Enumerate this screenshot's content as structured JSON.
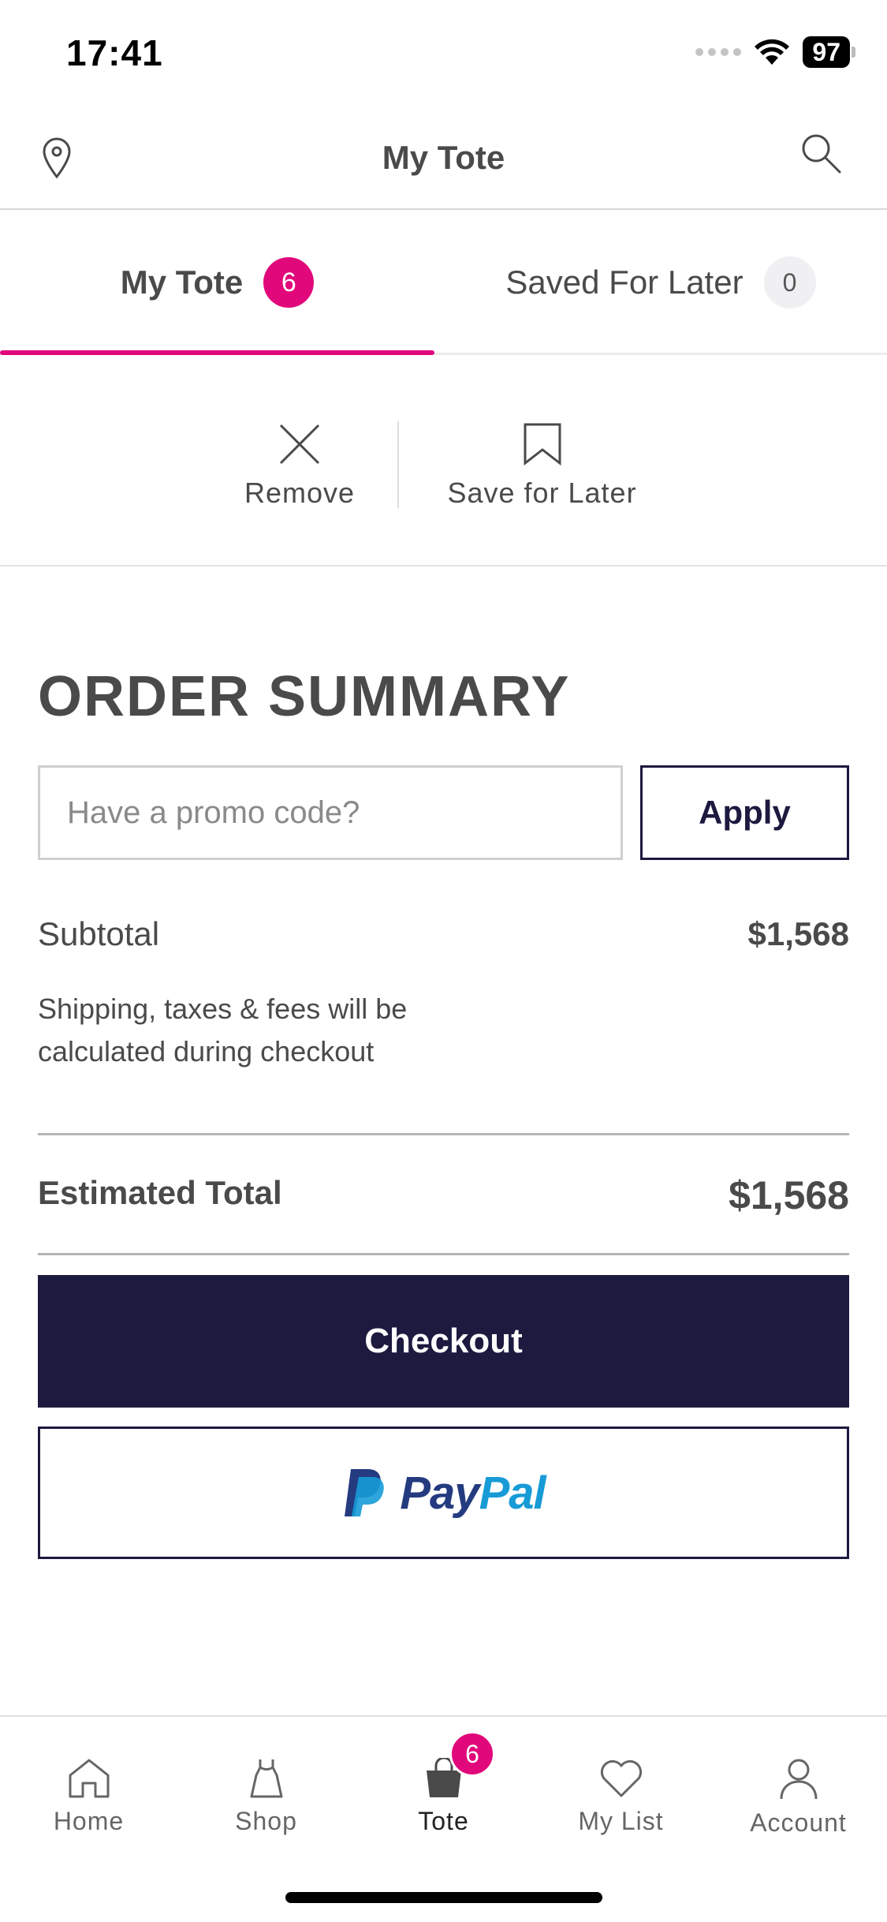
{
  "status_bar": {
    "time": "17:41",
    "battery": "97",
    "icons": [
      "cellular-signal-icon",
      "wifi-icon",
      "battery-icon"
    ]
  },
  "header": {
    "title": "My Tote",
    "icons": [
      "location-pin-icon",
      "search-icon"
    ]
  },
  "tabs": [
    {
      "label": "My Tote",
      "count": "6",
      "active": true
    },
    {
      "label": "Saved For Later",
      "count": "0",
      "active": false
    }
  ],
  "actions": {
    "remove": "Remove",
    "save_for_later": "Save for Later",
    "icons": [
      "close-icon",
      "bookmark-icon"
    ]
  },
  "summary": {
    "title": "ORDER SUMMARY",
    "promo_placeholder": "Have a promo code?",
    "promo_value": "",
    "apply": "Apply",
    "subtotal_label": "Subtotal",
    "subtotal_value": "$1,568",
    "shipping_note": "Shipping, taxes & fees will be calculated during checkout",
    "estimated_label": "Estimated Total",
    "estimated_value": "$1,568",
    "checkout": "Checkout",
    "paypal_pay": "Pay",
    "paypal_pal": "Pal"
  },
  "nav": {
    "items": [
      {
        "label": "Home",
        "icon": "home-icon"
      },
      {
        "label": "Shop",
        "icon": "dress-icon"
      },
      {
        "label": "Tote",
        "icon": "tote-bag-icon",
        "badge": "6",
        "active": true
      },
      {
        "label": "My List",
        "icon": "heart-icon"
      },
      {
        "label": "Account",
        "icon": "person-icon"
      }
    ]
  },
  "colors": {
    "accent": "#e0087a",
    "navy": "#1c1a3f",
    "text": "#4a4a4a",
    "paypal_dark": "#253b80",
    "paypal_light": "#179bd7"
  }
}
